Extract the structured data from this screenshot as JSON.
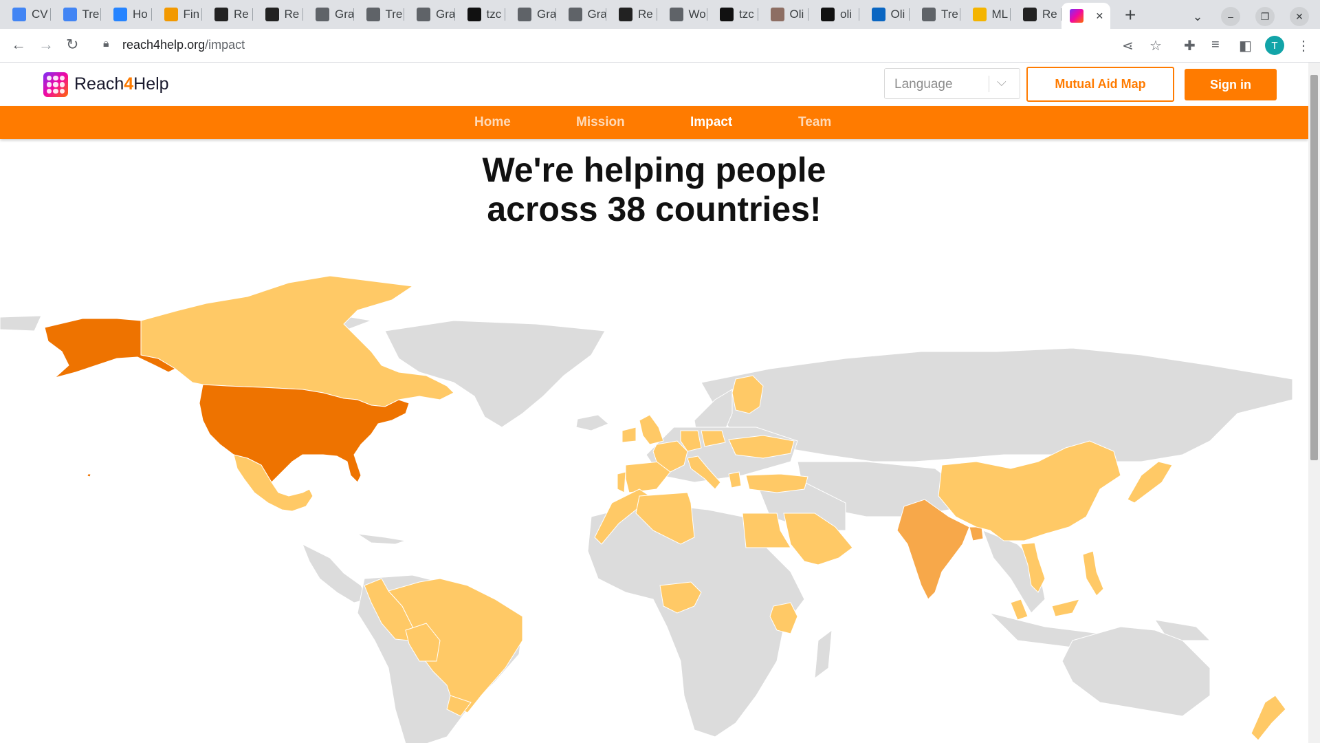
{
  "browser": {
    "tabs": [
      {
        "label": "CV",
        "icon": "docs-icon",
        "color": "#4285f4"
      },
      {
        "label": "Tre",
        "icon": "docs-icon",
        "color": "#4285f4"
      },
      {
        "label": "Ho",
        "icon": "jira-icon",
        "color": "#2684ff"
      },
      {
        "label": "Fin",
        "icon": "infinity-icon",
        "color": "#f29900"
      },
      {
        "label": "Re",
        "icon": "react-icon",
        "color": "#222"
      },
      {
        "label": "Re",
        "icon": "react-icon",
        "color": "#222"
      },
      {
        "label": "Gra",
        "icon": "globe-icon",
        "color": "#5f6368"
      },
      {
        "label": "Tre",
        "icon": "globe-icon",
        "color": "#5f6368"
      },
      {
        "label": "Gra",
        "icon": "globe-icon",
        "color": "#5f6368"
      },
      {
        "label": "tzc",
        "icon": "github-icon",
        "color": "#111"
      },
      {
        "label": "Gra",
        "icon": "globe-icon",
        "color": "#5f6368"
      },
      {
        "label": "Gra",
        "icon": "globe-icon",
        "color": "#5f6368"
      },
      {
        "label": "Re",
        "icon": "react-icon",
        "color": "#222"
      },
      {
        "label": "Wo",
        "icon": "globe-icon",
        "color": "#5f6368"
      },
      {
        "label": "tzc",
        "icon": "github-icon",
        "color": "#111"
      },
      {
        "label": "Oli",
        "icon": "avatar-icon",
        "color": "#8d6e63"
      },
      {
        "label": "oli",
        "icon": "github-icon",
        "color": "#111"
      },
      {
        "label": "Oli",
        "icon": "linkedin-icon",
        "color": "#0a66c2"
      },
      {
        "label": "Tre",
        "icon": "globe-icon",
        "color": "#5f6368"
      },
      {
        "label": "ML",
        "icon": "slides-icon",
        "color": "#f4b400"
      },
      {
        "label": "Re",
        "icon": "react-icon",
        "color": "#222"
      }
    ],
    "active_tab_icon": "reach4help-icon",
    "url_host": "reach4help.org",
    "url_path": "/impact",
    "profile_initial": "T"
  },
  "site": {
    "brand_prefix": "Reach",
    "brand_four": "4",
    "brand_suffix": "Help",
    "language_placeholder": "Language",
    "mutual_aid_button": "Mutual Aid Map",
    "signin_button": "Sign in",
    "nav": [
      "Home",
      "Mission",
      "Impact",
      "Team"
    ],
    "active_nav": "Impact",
    "headline_line1": "We're helping people",
    "headline_line2": "across 38 countries!"
  },
  "map": {
    "colors": {
      "no_data": "#dcdcdc",
      "low": "#ffc966",
      "medium": "#f7a84a",
      "high": "#ee7300",
      "brand": "#ff7b00"
    },
    "highlighted_regions": [
      {
        "id": "alaska",
        "level": "high"
      },
      {
        "id": "canada",
        "level": "low"
      },
      {
        "id": "usa",
        "level": "high"
      },
      {
        "id": "mexico",
        "level": "low"
      },
      {
        "id": "brazil",
        "level": "low"
      },
      {
        "id": "peru",
        "level": "low"
      },
      {
        "id": "bolivia",
        "level": "low"
      },
      {
        "id": "uruguay",
        "level": "low"
      },
      {
        "id": "portugal",
        "level": "low"
      },
      {
        "id": "spain",
        "level": "low"
      },
      {
        "id": "uk",
        "level": "low"
      },
      {
        "id": "ireland",
        "level": "low"
      },
      {
        "id": "france",
        "level": "low"
      },
      {
        "id": "italy",
        "level": "low"
      },
      {
        "id": "germany",
        "level": "low"
      },
      {
        "id": "poland",
        "level": "low"
      },
      {
        "id": "ukraine",
        "level": "low"
      },
      {
        "id": "finland",
        "level": "low"
      },
      {
        "id": "greece",
        "level": "low"
      },
      {
        "id": "turkey",
        "level": "low"
      },
      {
        "id": "morocco",
        "level": "low"
      },
      {
        "id": "algeria",
        "level": "low"
      },
      {
        "id": "egypt",
        "level": "low"
      },
      {
        "id": "saudi-arabia",
        "level": "low"
      },
      {
        "id": "nigeria",
        "level": "low"
      },
      {
        "id": "kenya",
        "level": "low"
      },
      {
        "id": "india",
        "level": "medium"
      },
      {
        "id": "bangladesh",
        "level": "medium"
      },
      {
        "id": "china",
        "level": "low"
      },
      {
        "id": "japan",
        "level": "low"
      },
      {
        "id": "vietnam",
        "level": "low"
      },
      {
        "id": "philippines",
        "level": "low"
      },
      {
        "id": "malaysia",
        "level": "low"
      },
      {
        "id": "new-zealand",
        "level": "low"
      },
      {
        "id": "hawaii",
        "level": "high"
      }
    ]
  }
}
